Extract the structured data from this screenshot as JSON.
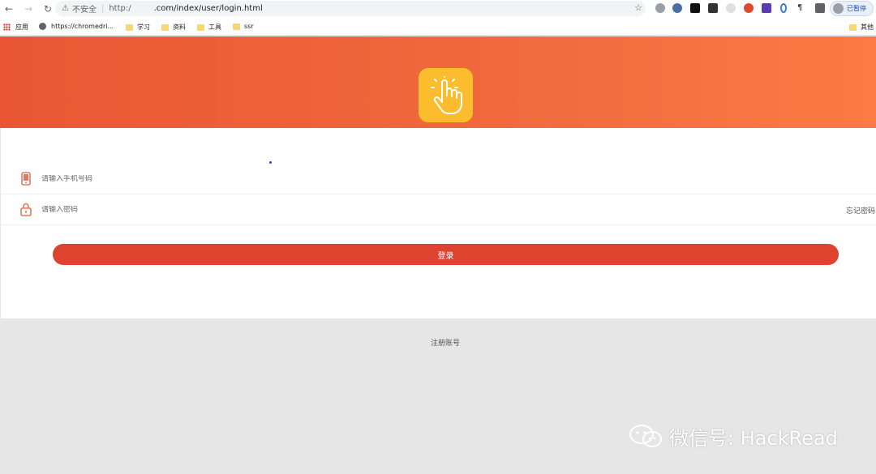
{
  "browser": {
    "not_secure_label": "不安全",
    "url_prefix": "http:/",
    "url_suffix": ".com/index/user/login.html",
    "profile_label": "已暂停",
    "bookmarks": [
      {
        "label": "应用"
      },
      {
        "label": "https://chromedri..."
      },
      {
        "label": "学习"
      },
      {
        "label": "资料"
      },
      {
        "label": "工具"
      },
      {
        "label": "ssr"
      },
      {
        "label": "其他"
      }
    ]
  },
  "login": {
    "phone_placeholder": "请输入手机号码",
    "password_placeholder": "请输入密码",
    "forgot_label": "忘记密码",
    "submit_label": "登录",
    "register_label": "注册账号"
  },
  "watermark": {
    "text": "微信号: HackRead"
  },
  "colors": {
    "header_start": "#ea5634",
    "header_end": "#fd7a44",
    "logo_bg": "#fbbd2e",
    "button": "#de4330",
    "icon": "#e07a5f"
  }
}
